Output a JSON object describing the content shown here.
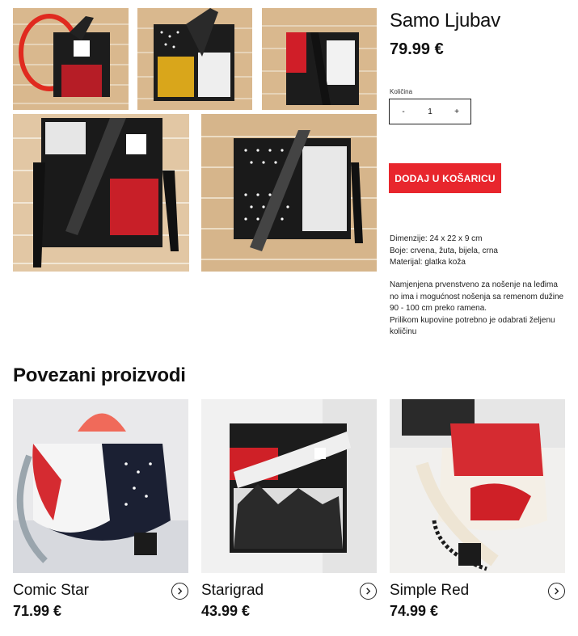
{
  "product": {
    "title": "Samo Ljubav",
    "price": "79.99 €",
    "quantity_label": "Količina",
    "quantity_value": "1",
    "decrement_label": "-",
    "increment_label": "+",
    "add_to_cart_label": "DODAJ U KOŠARICU",
    "specs": [
      "Dimenzije: 24 x 22 x 9 cm",
      "Boje: crvena, žuta, bijela, crna",
      "Materijal: glatka koža"
    ],
    "description": [
      "Namjenjena prvenstveno za nošenje na leđima",
      "no ima i mogućnost nošenja sa remenom dužine",
      "90 - 100 cm preko ramena.",
      "Prilikom kupovine potrebno je odabrati željenu",
      "količinu"
    ]
  },
  "related": {
    "title": "Povezani proizvodi",
    "items": [
      {
        "name": "Comic Star",
        "price": "71.99 €"
      },
      {
        "name": "Starigrad",
        "price": "43.99 €"
      },
      {
        "name": "Simple Red",
        "price": "74.99 €"
      }
    ]
  },
  "colors": {
    "accent": "#e8262d",
    "text": "#111111"
  }
}
